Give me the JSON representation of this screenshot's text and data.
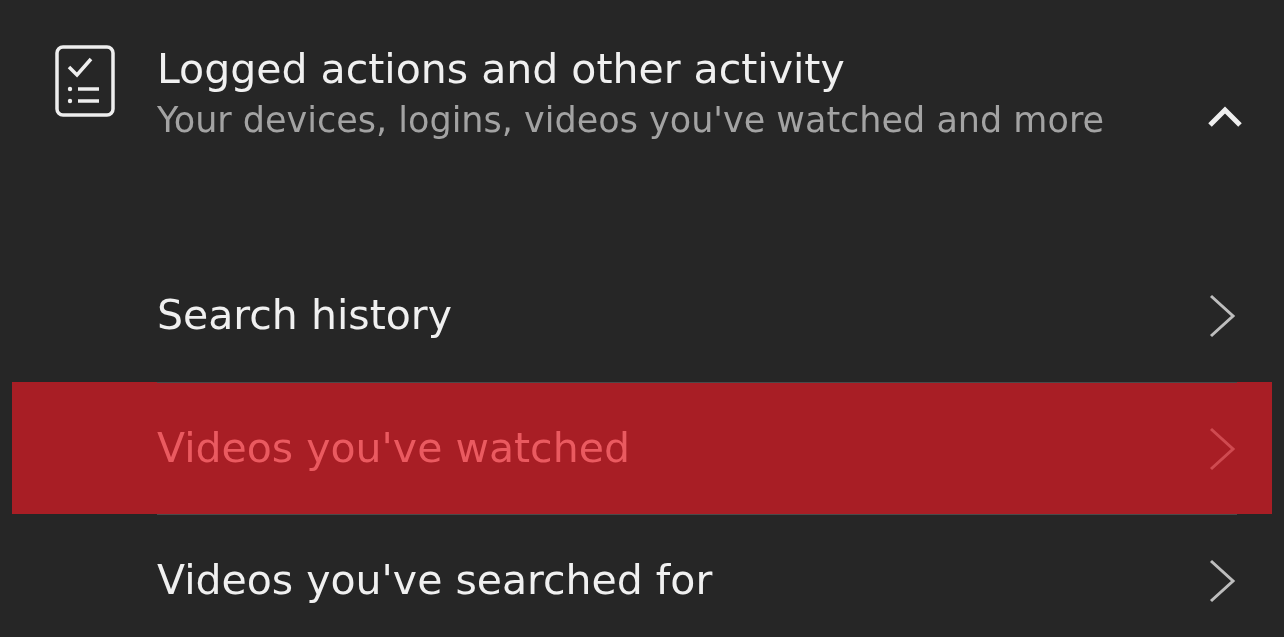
{
  "section": {
    "title": "Logged actions and other activity",
    "subtitle": "Your devices, logins, videos you've watched and more",
    "expanded": true
  },
  "items": [
    {
      "label": "Search history",
      "selected": false
    },
    {
      "label": "Videos you've watched",
      "selected": true
    },
    {
      "label": "Videos you've searched for",
      "selected": false
    }
  ]
}
